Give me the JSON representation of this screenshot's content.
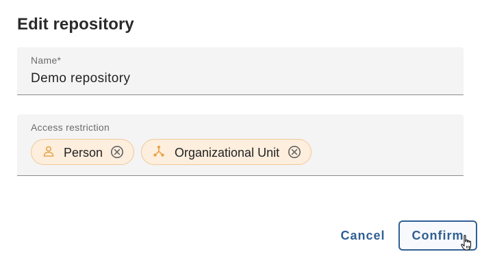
{
  "dialog": {
    "title": "Edit repository",
    "name_field": {
      "label": "Name*",
      "value": "Demo repository"
    },
    "access_field": {
      "label": "Access restriction",
      "chips": [
        {
          "label": "Person",
          "icon": "person-icon"
        },
        {
          "label": "Organizational Unit",
          "icon": "org-unit-icon"
        }
      ]
    },
    "actions": {
      "cancel_label": "Cancel",
      "confirm_label": "Confirm"
    }
  },
  "colors": {
    "accent": "#2f5f93",
    "chip_background": "#fdeedd",
    "chip_border": "#f0c89a",
    "chip_icon": "#e8a44a",
    "field_background": "#f4f4f4"
  }
}
